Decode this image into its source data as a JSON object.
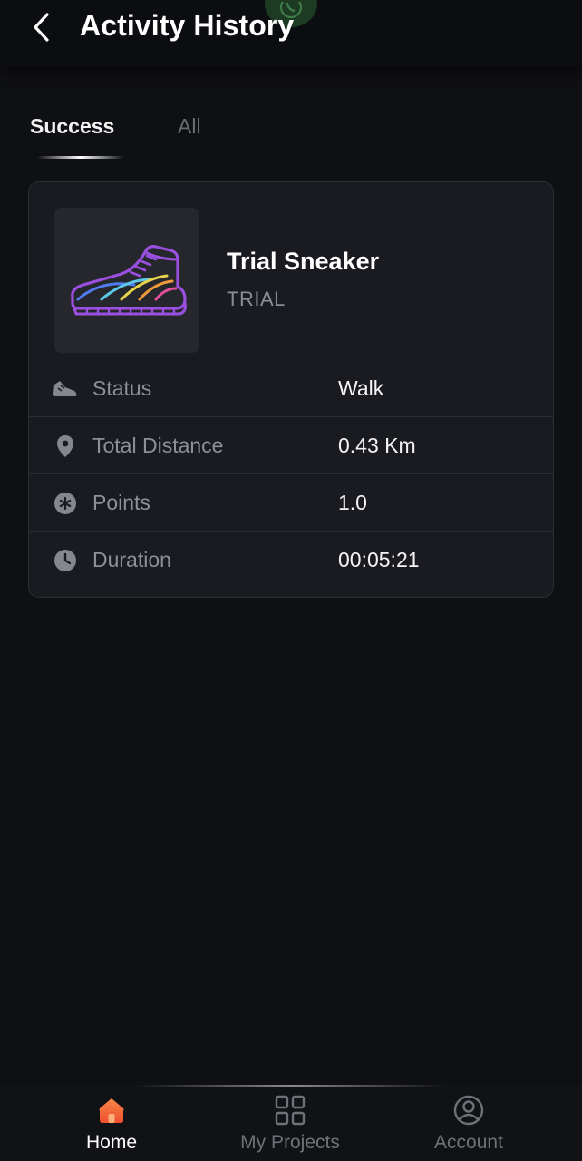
{
  "header": {
    "title": "Activity History",
    "back_icon": "chevron-left-icon",
    "floating_icon": "whatsapp-icon"
  },
  "tabs": [
    {
      "label": "Success",
      "active": true
    },
    {
      "label": "All",
      "active": false
    }
  ],
  "activity": {
    "item_name": "Trial Sneaker",
    "item_type": "TRIAL",
    "item_icon": "sneaker-icon",
    "rows": [
      {
        "icon": "shoe-icon",
        "label": "Status",
        "value": "Walk"
      },
      {
        "icon": "location-pin-icon",
        "label": "Total Distance",
        "value": "0.43 Km"
      },
      {
        "icon": "points-badge-icon",
        "label": "Points",
        "value": "1.0"
      },
      {
        "icon": "clock-icon",
        "label": "Duration",
        "value": "00:05:21"
      }
    ]
  },
  "bottom_nav": [
    {
      "label": "Home",
      "icon": "home-icon",
      "active": true
    },
    {
      "label": "My Projects",
      "icon": "grid-icon",
      "active": false
    },
    {
      "label": "Account",
      "icon": "user-circle-icon",
      "active": false
    }
  ],
  "colors": {
    "background": "#0f1013",
    "card": "#1a1b20",
    "accent_home": "#f2653a",
    "sneaker_outline": "#9b4fe0"
  }
}
